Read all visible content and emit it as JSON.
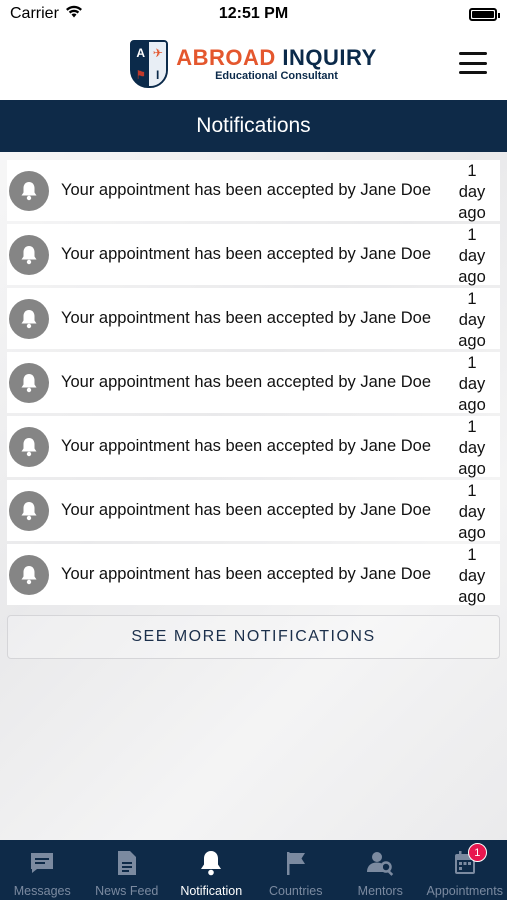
{
  "status_bar": {
    "carrier": "Carrier",
    "time": "12:51 PM"
  },
  "header": {
    "brand_part1": "ABROAD",
    "brand_part2": "INQUIRY",
    "brand_sub": "Educational Consultant",
    "logo_letters": [
      "A",
      "I"
    ]
  },
  "title": "Notifications",
  "notifications": [
    {
      "text": "Your appointment has been accepted by Jane Doe",
      "time_num": "1",
      "time_unit": "day",
      "time_suffix": "ago"
    },
    {
      "text": "Your appointment has been accepted by Jane Doe",
      "time_num": "1",
      "time_unit": "day",
      "time_suffix": "ago"
    },
    {
      "text": "Your appointment has been accepted by Jane Doe",
      "time_num": "1",
      "time_unit": "day",
      "time_suffix": "ago"
    },
    {
      "text": "Your appointment has been accepted by Jane Doe",
      "time_num": "1",
      "time_unit": "day",
      "time_suffix": "ago"
    },
    {
      "text": "Your appointment has been accepted by Jane Doe",
      "time_num": "1",
      "time_unit": "day",
      "time_suffix": "ago"
    },
    {
      "text": "Your appointment has been accepted by Jane Doe",
      "time_num": "1",
      "time_unit": "day",
      "time_suffix": "ago"
    },
    {
      "text": "Your appointment has been accepted by Jane Doe",
      "time_num": "1",
      "time_unit": "day",
      "time_suffix": "ago"
    }
  ],
  "see_more_label": "SEE MORE NOTIFICATIONS",
  "tabs": [
    {
      "label": "Messages",
      "icon": "message-icon"
    },
    {
      "label": "News Feed",
      "icon": "news-feed-icon"
    },
    {
      "label": "Notification",
      "icon": "bell-icon",
      "active": true
    },
    {
      "label": "Countries",
      "icon": "flag-icon"
    },
    {
      "label": "Mentors",
      "icon": "mentor-search-icon"
    },
    {
      "label": "Appointments",
      "icon": "calendar-icon",
      "badge": "1"
    }
  ],
  "colors": {
    "primary_navy": "#0e2a48",
    "brand_orange": "#e4572e",
    "badge_red": "#e8174f",
    "notif_icon_gray": "#858585"
  }
}
